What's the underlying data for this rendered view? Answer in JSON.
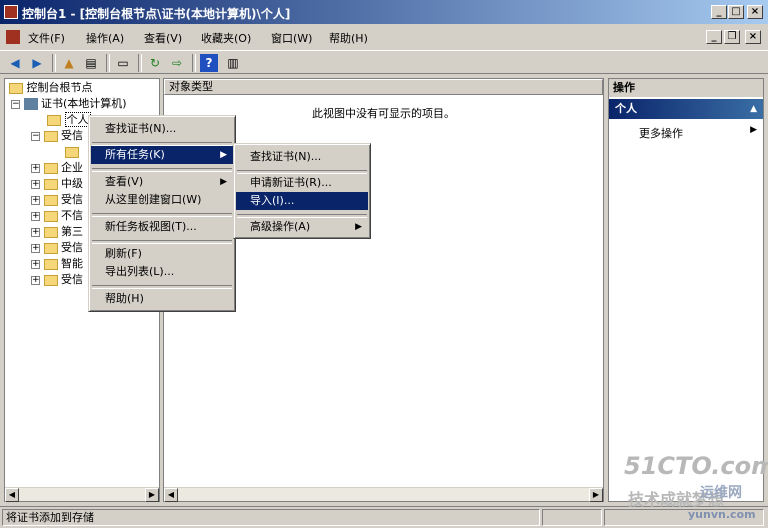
{
  "window": {
    "title": "控制台1 - [控制台根节点\\证书(本地计算机)\\个人]",
    "min_btn": "_",
    "max_btn": "□",
    "close_btn": "×",
    "inner_min": "_",
    "inner_restore": "❐",
    "inner_close": "×"
  },
  "menubar": [
    {
      "name": "menu-file",
      "label": "文件(F)"
    },
    {
      "name": "menu-action",
      "label": "操作(A)"
    },
    {
      "name": "menu-view",
      "label": "查看(V)"
    },
    {
      "name": "menu-favorites",
      "label": "收藏夹(O)"
    },
    {
      "name": "menu-window",
      "label": "窗口(W)"
    },
    {
      "name": "menu-help",
      "label": "帮助(H)"
    }
  ],
  "toolbar": [
    "back-icon",
    "forward-icon",
    "up-folder-icon",
    "show-tree-icon",
    "properties-icon",
    "refresh-icon",
    "export-icon",
    "help-icon",
    "action-pane-icon"
  ],
  "tree": {
    "root": "控制台根节点",
    "cert": "证书(本地计算机)",
    "personal": "个人",
    "items": [
      "受信",
      "企业",
      "中级",
      "受信",
      "不信",
      "第三",
      "受信",
      "智能",
      "受信"
    ]
  },
  "content": {
    "header": "对象类型",
    "empty_message": "此视图中没有可显示的项目。"
  },
  "actions": {
    "header": "操作",
    "section": "个人",
    "more": "更多操作"
  },
  "context_menu": {
    "find": "查找证书(N)...",
    "all_tasks": "所有任务(K)",
    "view": "查看(V)",
    "new_window": "从这里创建窗口(W)",
    "new_taskpad": "新任务板视图(T)...",
    "refresh": "刷新(F)",
    "export_list": "导出列表(L)...",
    "help": "帮助(H)"
  },
  "submenu": {
    "find": "查找证书(N)...",
    "request": "申请新证书(R)...",
    "import": "导入(I)...",
    "advanced": "高级操作(A)"
  },
  "status": {
    "text": "将证书添加到存储"
  },
  "watermark": {
    "logo": "51CTO.com",
    "line2": "技术成就梦想",
    "site_name": "运维网",
    "site_url": "yunvn.com"
  }
}
